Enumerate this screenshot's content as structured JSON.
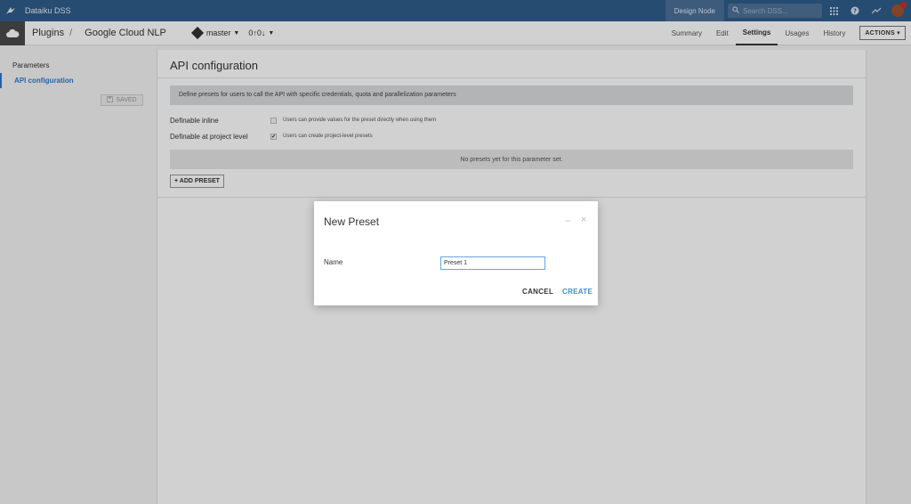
{
  "topnav": {
    "brand": "Dataiku DSS",
    "node_label": "Design Node",
    "search_placeholder": "Search DSS..."
  },
  "subbar": {
    "crumb_root": "Plugins",
    "crumb_separator": "/",
    "crumb_current": "Google Cloud NLP",
    "branch": "master",
    "counts": "0↑0↓",
    "tabs": [
      {
        "label": "Summary"
      },
      {
        "label": "Edit"
      },
      {
        "label": "Settings"
      },
      {
        "label": "Usages"
      },
      {
        "label": "History"
      }
    ],
    "actions_label": "ACTIONS"
  },
  "sidebar": {
    "items": [
      {
        "label": "Parameters"
      },
      {
        "label": "API configuration"
      }
    ],
    "saved_label": "SAVED"
  },
  "main": {
    "title": "API configuration",
    "info": "Define presets for users to call the API with specific credentials, quota and parallelization parameters",
    "definable_inline_label": "Definable inline",
    "definable_inline_text": "Users can provide values for the preset directly when using them",
    "definable_project_label": "Definable at project level",
    "definable_project_text": "Users can create project-level presets",
    "no_presets": "No presets yet for this parameter set.",
    "add_preset": "+ ADD PRESET"
  },
  "modal": {
    "title": "New Preset",
    "minimize": "–",
    "close": "×",
    "name_label": "Name",
    "name_value": "Preset 1",
    "cancel": "CANCEL",
    "create": "CREATE"
  },
  "colors": {
    "topnav": "#2f5d8c",
    "accent": "#2b7bd0",
    "create": "#3b8ee0"
  }
}
